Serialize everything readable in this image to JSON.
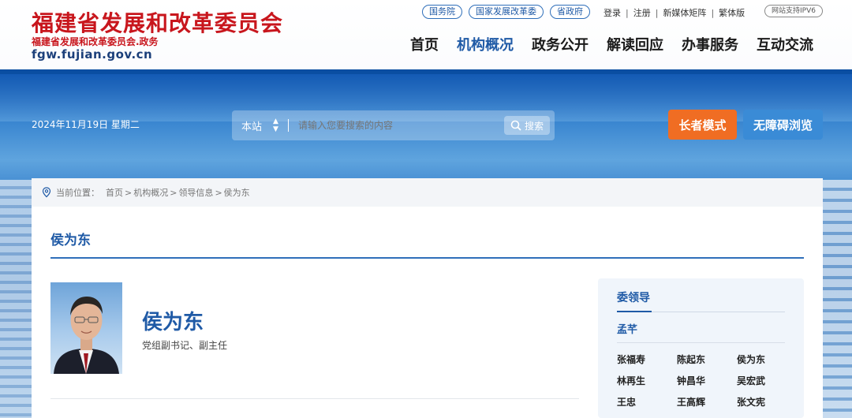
{
  "header": {
    "logo_main": "福建省发展和改革委员会",
    "logo_sub": "福建省发展和改革委员会.政务",
    "logo_url": "fgw.fujian.gov.cn",
    "top_links": [
      "国务院",
      "国家发展改革委",
      "省政府"
    ],
    "util_links": [
      "登录",
      "注册",
      "新媒体矩阵",
      "繁体版"
    ],
    "ipv6": "网站支持IPV6",
    "nav": [
      "首页",
      "机构概况",
      "政务公开",
      "解读回应",
      "办事服务",
      "互动交流"
    ],
    "nav_active_index": 1
  },
  "banner": {
    "date": "2024年11月19日 星期二",
    "search_scope": "本站",
    "search_placeholder": "请输入您要搜索的内容",
    "search_button": "搜索",
    "elder_mode": "长者模式",
    "accessible": "无障碍浏览"
  },
  "content": {
    "breadcrumb_label": "当前位置：",
    "breadcrumb": [
      "首页",
      "机构概况",
      "领导信息",
      "侯为东"
    ],
    "page_title": "侯为东",
    "name": "侯为东",
    "role": "党组副书记、副主任"
  },
  "sidebar": {
    "title": "委领导",
    "lead": "孟芊",
    "members": [
      "张福寿",
      "陈起东",
      "侯为东",
      "林再生",
      "钟昌华",
      "吴宏武",
      "王忠",
      "王高辉",
      "张文宪"
    ]
  },
  "colors": {
    "brand_red": "#c8161d",
    "brand_blue": "#1f5aa6",
    "elder_orange": "#f06d23",
    "access_blue": "#3a8bd6"
  }
}
